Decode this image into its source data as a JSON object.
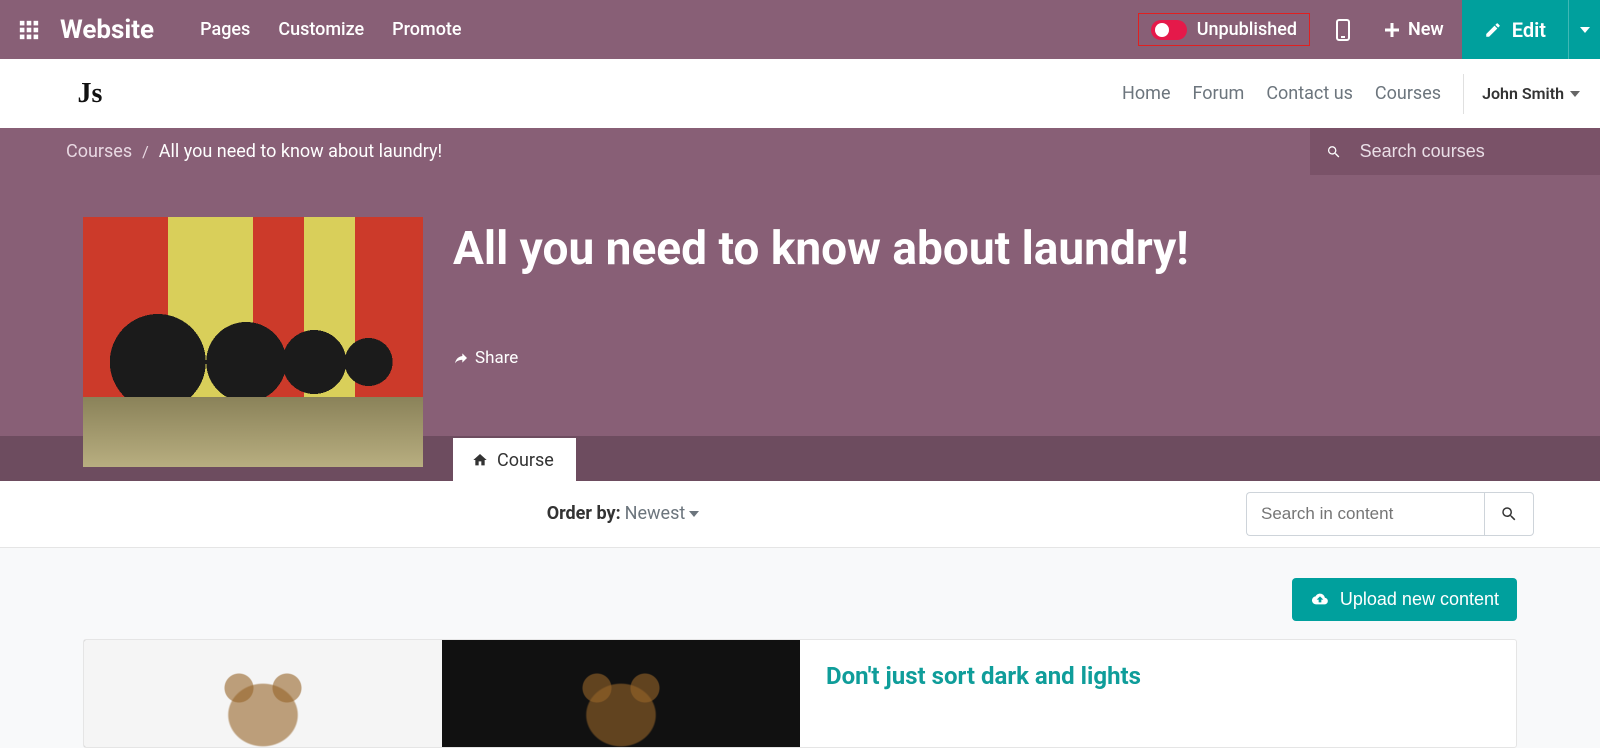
{
  "admin": {
    "brand": "Website",
    "menu": [
      "Pages",
      "Customize",
      "Promote"
    ],
    "publish_label": "Unpublished",
    "new_label": "New",
    "edit_label": "Edit"
  },
  "site_nav": {
    "logo_text": "Js",
    "items": [
      "Home",
      "Forum",
      "Contact us",
      "Courses"
    ],
    "user": "John Smith"
  },
  "breadcrumb": {
    "root": "Courses",
    "current": "All you need to know about laundry!",
    "search_placeholder": "Search courses"
  },
  "hero": {
    "title": "All you need to know about laundry!",
    "share_label": "Share",
    "tab_label": "Course"
  },
  "filter": {
    "order_label": "Order by",
    "order_value": "Newest",
    "search_placeholder": "Search in content"
  },
  "content": {
    "upload_label": "Upload new content",
    "items": [
      {
        "title": "Don't just sort dark and lights"
      }
    ]
  },
  "colors": {
    "primary_purple": "#885f76",
    "teal": "#00a09d",
    "danger": "#e5194a"
  }
}
